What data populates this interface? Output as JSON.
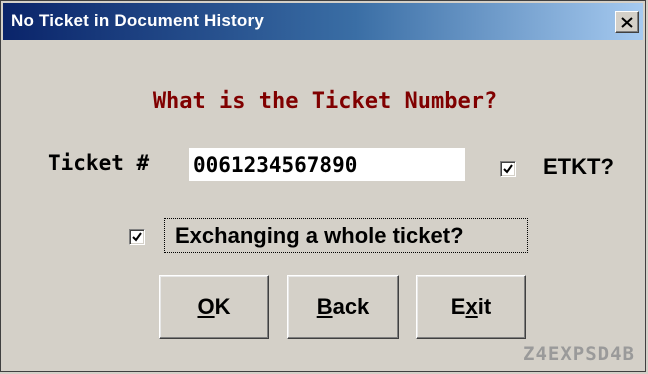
{
  "window": {
    "title": "No Ticket in Document History",
    "close_icon": "close-icon"
  },
  "dialog": {
    "question": "What is the Ticket Number?",
    "ticket_label": "Ticket #",
    "ticket_value": "0061234567890",
    "etkt": {
      "label": "ETKT?",
      "checked": true
    },
    "exchange": {
      "label": "Exchanging a whole ticket?",
      "checked": true
    }
  },
  "buttons": {
    "ok": {
      "mnemonic": "O",
      "rest": "K"
    },
    "back": {
      "mnemonic": "B",
      "rest": "ack"
    },
    "exit": {
      "pre": "E",
      "mnemonic": "x",
      "rest": "it"
    }
  },
  "screen_code": "Z4EXPSD4B"
}
